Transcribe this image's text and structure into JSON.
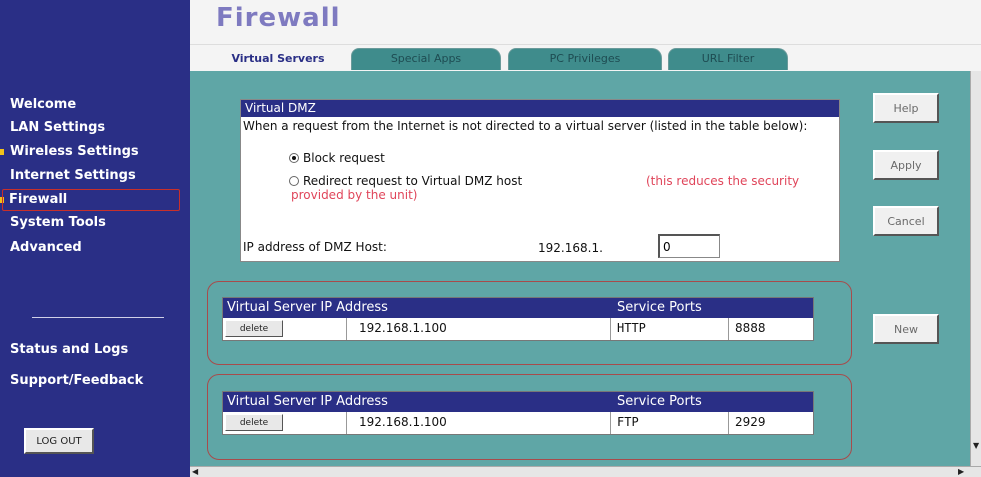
{
  "header": {
    "title": "Firewall"
  },
  "tabs": [
    {
      "label": "Virtual Servers",
      "active": true
    },
    {
      "label": "Special Apps",
      "active": false
    },
    {
      "label": "PC Privileges",
      "active": false
    },
    {
      "label": "URL Filter",
      "active": false
    }
  ],
  "sidebar": {
    "items": [
      {
        "label": "Welcome"
      },
      {
        "label": "LAN Settings"
      },
      {
        "label": "Wireless Settings"
      },
      {
        "label": "Internet Settings"
      },
      {
        "label": "Firewall",
        "active": true
      },
      {
        "label": "System Tools"
      },
      {
        "label": "Advanced"
      },
      {
        "label": "Status and Logs"
      },
      {
        "label": "Support/Feedback"
      }
    ],
    "logout_label": "LOG OUT"
  },
  "dmz": {
    "title": "Virtual DMZ",
    "description": "When a request from the Internet is not directed to a virtual server (listed in the table below):",
    "option_block": "Block request",
    "option_redirect": "Redirect request to Virtual DMZ host",
    "warning": "(this reduces the security provided by the unit)",
    "selected": "block",
    "ip_label": "IP address of DMZ Host:",
    "ip_prefix": "192.168.1.",
    "ip_value": "0"
  },
  "virtual_servers": {
    "header_ip": "Virtual Server IP Address",
    "header_ports": "Service Ports",
    "delete_label": "delete",
    "rows": [
      {
        "ip": "192.168.1.100",
        "service": "HTTP",
        "port": "8888"
      },
      {
        "ip": "192.168.1.100",
        "service": "FTP",
        "port": "2929"
      }
    ]
  },
  "buttons": {
    "help": "Help",
    "apply": "Apply",
    "cancel": "Cancel",
    "new": "New"
  },
  "colors": {
    "sidebar": "#2a2f86",
    "content": "#5fa6a6",
    "warning": "#e0455a",
    "active_border": "#c8302a"
  }
}
